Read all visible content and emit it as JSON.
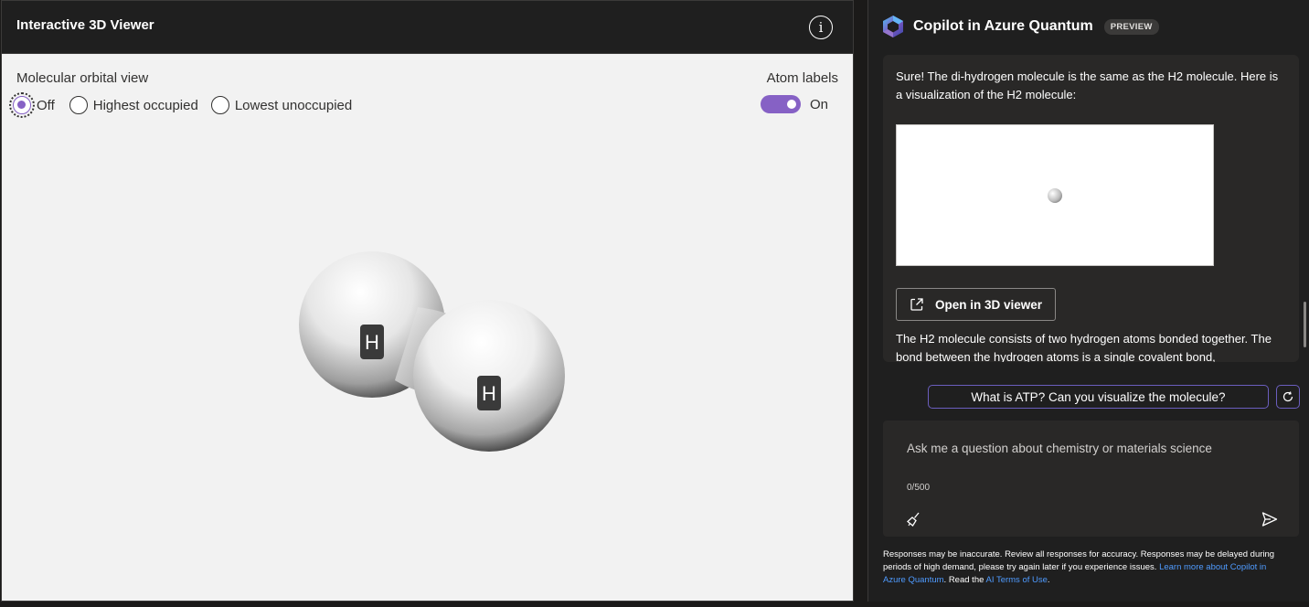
{
  "viewer": {
    "title": "Interactive 3D Viewer",
    "info_icon": "info-icon",
    "orbital_label": "Molecular orbital view",
    "orbital_options": [
      "Off",
      "Highest occupied",
      "Lowest unoccupied"
    ],
    "orbital_selected": "Off",
    "atom_labels_title": "Atom labels",
    "atom_labels_state": "On",
    "atoms": [
      "H",
      "H"
    ]
  },
  "copilot": {
    "title": "Copilot in Azure Quantum",
    "badge": "PREVIEW",
    "message_p1": "Sure! The di-hydrogen molecule is the same as the H2 molecule. Here is a visualization of the H2 molecule:",
    "open_button": "Open in 3D viewer",
    "message_p2": "The H2 molecule consists of two hydrogen atoms bonded together. The bond between the hydrogen atoms is a single covalent bond,",
    "suggestion": "What is ATP? Can you visualize the molecule?",
    "input_placeholder": "Ask me a question about chemistry or materials science",
    "counter": "0/500",
    "disclaimer_text": "Responses may be inaccurate. Review all responses for accuracy. Responses may be delayed during periods of high demand, please try again later if you experience issues.",
    "disclaimer_link1": "Learn more about Copilot in Azure Quantum",
    "disclaimer_mid": ". Read the ",
    "disclaimer_link2": "AI Terms of Use",
    "disclaimer_end": "."
  },
  "colors": {
    "accent": "#8661c5",
    "link": "#4f9bff",
    "panel_dark": "#1f1f1f",
    "viewer_bg": "#f2f2f2"
  }
}
